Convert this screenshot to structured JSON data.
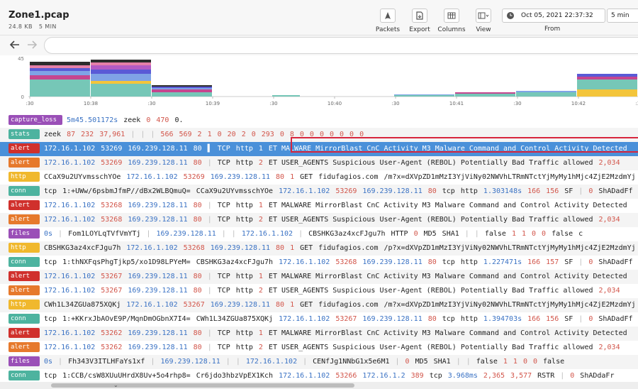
{
  "header": {
    "title": "Zone1.pcap",
    "size": "24.8 KB",
    "duration": "5 MIN",
    "tools": [
      {
        "label": "Packets",
        "icon": "shark-fin-icon"
      },
      {
        "label": "Export",
        "icon": "export-file-icon"
      },
      {
        "label": "Columns",
        "icon": "columns-icon"
      },
      {
        "label": "View",
        "icon": "view-layout-icon"
      }
    ],
    "date": "Oct 05, 2021 22:37:32",
    "span": "5 min",
    "from_label": "From"
  },
  "search": {
    "placeholder": ""
  },
  "histogram": {
    "y_ticks": [
      "45",
      "0"
    ],
    "x_ticks": [
      ":30",
      "10:38",
      ":30",
      "10:39",
      ":30",
      "10:40",
      ":30",
      "10:41",
      ":30",
      "10:42",
      ":30"
    ],
    "colors": [
      "#76c7b7",
      "#f3c53b",
      "#c5468f",
      "#7fa3e6",
      "#5a5ad6",
      "#b45bc4",
      "#e57fa8",
      "#2c2c2c"
    ],
    "bars": [
      {
        "x": 42,
        "w": 86,
        "stack": [
          [
            0,
            24
          ],
          [
            2,
            6
          ],
          [
            3,
            6
          ],
          [
            4,
            4
          ],
          [
            6,
            4
          ],
          [
            7,
            5
          ]
        ]
      },
      {
        "x": 128,
        "w": 86,
        "stack": [
          [
            0,
            18
          ],
          [
            1,
            4
          ],
          [
            3,
            10
          ],
          [
            4,
            6
          ],
          [
            5,
            6
          ],
          [
            6,
            4
          ],
          [
            7,
            4
          ]
        ]
      },
      {
        "x": 214,
        "w": 86,
        "stack": [
          [
            0,
            6
          ],
          [
            2,
            4
          ],
          [
            3,
            2
          ],
          [
            4,
            2
          ],
          [
            7,
            2
          ]
        ]
      },
      {
        "x": 384,
        "w": 40,
        "stack": [
          [
            0,
            2
          ]
        ]
      },
      {
        "x": 556,
        "w": 86,
        "stack": [
          [
            0,
            2
          ],
          [
            3,
            1
          ]
        ]
      },
      {
        "x": 642,
        "w": 86,
        "stack": [
          [
            0,
            4
          ],
          [
            2,
            2
          ]
        ]
      },
      {
        "x": 728,
        "w": 86,
        "stack": [
          [
            0,
            6
          ],
          [
            3,
            2
          ]
        ]
      },
      {
        "x": 814,
        "w": 86,
        "stack": [
          [
            1,
            10
          ],
          [
            0,
            14
          ],
          [
            2,
            4
          ],
          [
            4,
            4
          ]
        ]
      }
    ]
  },
  "rows": [
    {
      "type": "capture_loss",
      "color": "#9a4fb7",
      "wide": true,
      "fields": [
        {
          "t": "5m45.501172s",
          "c": "dur"
        },
        {
          "t": "zeek"
        },
        {
          "t": "0",
          "c": "num"
        },
        {
          "t": "470",
          "c": "num"
        },
        {
          "t": "0."
        }
      ]
    },
    {
      "type": "stats",
      "color": "#4db39f",
      "fields": [
        {
          "t": "zeek"
        },
        {
          "t": "87",
          "c": "num"
        },
        {
          "t": "232",
          "c": "num"
        },
        {
          "t": "37,961",
          "c": "num"
        },
        {
          "t": "|",
          "c": "sep"
        },
        {
          "t": "|",
          "c": "sep"
        },
        {
          "t": "|",
          "c": "sep"
        },
        {
          "t": "566",
          "c": "num"
        },
        {
          "t": "569",
          "c": "num"
        },
        {
          "t": "2",
          "c": "num"
        },
        {
          "t": "1",
          "c": "num"
        },
        {
          "t": "0",
          "c": "num"
        },
        {
          "t": "20",
          "c": "num"
        },
        {
          "t": "2",
          "c": "num"
        },
        {
          "t": "0",
          "c": "num"
        },
        {
          "t": "293",
          "c": "num"
        },
        {
          "t": "0",
          "c": "num"
        },
        {
          "t": "8",
          "c": "num"
        },
        {
          "t": "0",
          "c": "num"
        },
        {
          "t": "0",
          "c": "num"
        },
        {
          "t": "0",
          "c": "num"
        },
        {
          "t": "0",
          "c": "num"
        },
        {
          "t": "0",
          "c": "num"
        },
        {
          "t": "0",
          "c": "num"
        },
        {
          "t": "0",
          "c": "num"
        }
      ]
    },
    {
      "type": "alert",
      "color": "#d0302c",
      "selected": true,
      "fields": [
        {
          "t": "172.16.1.102",
          "c": "ip"
        },
        {
          "t": "53269",
          "c": "num"
        },
        {
          "t": "169.239.128.11",
          "c": "ip"
        },
        {
          "t": "80",
          "c": "num"
        },
        {
          "t": "▌",
          "c": "sep"
        },
        {
          "t": "TCP"
        },
        {
          "t": "http"
        },
        {
          "t": "1",
          "c": "num"
        },
        {
          "t": "ET MALWARE MirrorBlast CnC Activity M3  Malware Command and Control Activity Detected"
        }
      ]
    },
    {
      "type": "alert",
      "color": "#e6792c",
      "fields": [
        {
          "t": "172.16.1.102",
          "c": "ip"
        },
        {
          "t": "53269",
          "c": "num"
        },
        {
          "t": "169.239.128.11",
          "c": "ip"
        },
        {
          "t": "80",
          "c": "num"
        },
        {
          "t": "|",
          "c": "sep"
        },
        {
          "t": "TCP"
        },
        {
          "t": "http"
        },
        {
          "t": "2",
          "c": "num"
        },
        {
          "t": "ET USER_AGENTS Suspicious User-Agent (REBOL)  Potentially Bad Traffic  allowed"
        },
        {
          "t": "2,034",
          "c": "num"
        }
      ]
    },
    {
      "type": "http",
      "color": "#f0b82d",
      "fields": [
        {
          "t": "CCaX9u2UYvmsschYOe"
        },
        {
          "t": "172.16.1.102",
          "c": "ip"
        },
        {
          "t": "53269",
          "c": "num"
        },
        {
          "t": "169.239.128.11",
          "c": "ip"
        },
        {
          "t": "80",
          "c": "num"
        },
        {
          "t": "1",
          "c": "num"
        },
        {
          "t": "GET"
        },
        {
          "t": "fidufagios.com"
        },
        {
          "t": "/m?x=dXVpZD1mMzI3YjViNy02NWVhLTRmNTctYjMyMy1hMjc4ZjE2MzdmYj"
        }
      ]
    },
    {
      "type": "conn",
      "color": "#4db39f",
      "fields": [
        {
          "t": "tcp"
        },
        {
          "t": "1:+UWw/6psbmJfmP//dBx2WLBQmuQ="
        },
        {
          "t": "CCaX9u2UYvmsschYOe"
        },
        {
          "t": "172.16.1.102",
          "c": "ip"
        },
        {
          "t": "53269",
          "c": "num"
        },
        {
          "t": "169.239.128.11",
          "c": "ip"
        },
        {
          "t": "80",
          "c": "num"
        },
        {
          "t": "tcp"
        },
        {
          "t": "http"
        },
        {
          "t": "1.303148s",
          "c": "dur"
        },
        {
          "t": "166",
          "c": "num"
        },
        {
          "t": "156",
          "c": "num"
        },
        {
          "t": "SF"
        },
        {
          "t": "|",
          "c": "sep"
        },
        {
          "t": "0",
          "c": "num"
        },
        {
          "t": "ShADadFf"
        }
      ]
    },
    {
      "type": "alert",
      "color": "#d0302c",
      "fields": [
        {
          "t": "172.16.1.102",
          "c": "ip"
        },
        {
          "t": "53268",
          "c": "num"
        },
        {
          "t": "169.239.128.11",
          "c": "ip"
        },
        {
          "t": "80",
          "c": "num"
        },
        {
          "t": "|",
          "c": "sep"
        },
        {
          "t": "TCP"
        },
        {
          "t": "http"
        },
        {
          "t": "1",
          "c": "num"
        },
        {
          "t": "ET MALWARE MirrorBlast CnC Activity M3  Malware Command and Control Activity Detected"
        }
      ]
    },
    {
      "type": "alert",
      "color": "#e6792c",
      "fields": [
        {
          "t": "172.16.1.102",
          "c": "ip"
        },
        {
          "t": "53268",
          "c": "num"
        },
        {
          "t": "169.239.128.11",
          "c": "ip"
        },
        {
          "t": "80",
          "c": "num"
        },
        {
          "t": "|",
          "c": "sep"
        },
        {
          "t": "TCP"
        },
        {
          "t": "http"
        },
        {
          "t": "2",
          "c": "num"
        },
        {
          "t": "ET USER_AGENTS Suspicious User-Agent (REBOL)  Potentially Bad Traffic  allowed"
        },
        {
          "t": "2,034",
          "c": "num"
        }
      ]
    },
    {
      "type": "files",
      "color": "#9a4fb7",
      "fields": [
        {
          "t": "0s",
          "c": "dur"
        },
        {
          "t": "|",
          "c": "sep"
        },
        {
          "t": "Fom1LOYLqTVfVmYTj"
        },
        {
          "t": "|",
          "c": "sep"
        },
        {
          "t": "169.239.128.11",
          "c": "ip"
        },
        {
          "t": "|",
          "c": "sep"
        },
        {
          "t": "|",
          "c": "sep"
        },
        {
          "t": "172.16.1.102",
          "c": "ip"
        },
        {
          "t": "|",
          "c": "sep"
        },
        {
          "t": "CBSHKG3az4xcFJgu7h"
        },
        {
          "t": "HTTP"
        },
        {
          "t": "0",
          "c": "num"
        },
        {
          "t": "MD5"
        },
        {
          "t": "SHA1"
        },
        {
          "t": "|",
          "c": "sep"
        },
        {
          "t": "|",
          "c": "sep"
        },
        {
          "t": "false"
        },
        {
          "t": "1",
          "c": "num"
        },
        {
          "t": "1",
          "c": "num"
        },
        {
          "t": "0",
          "c": "num"
        },
        {
          "t": "0",
          "c": "num"
        },
        {
          "t": "false"
        },
        {
          "t": "c"
        }
      ]
    },
    {
      "type": "http",
      "color": "#f0b82d",
      "fields": [
        {
          "t": "CBSHKG3az4xcFJgu7h"
        },
        {
          "t": "172.16.1.102",
          "c": "ip"
        },
        {
          "t": "53268",
          "c": "num"
        },
        {
          "t": "169.239.128.11",
          "c": "ip"
        },
        {
          "t": "80",
          "c": "num"
        },
        {
          "t": "1",
          "c": "num"
        },
        {
          "t": "GET"
        },
        {
          "t": "fidufagios.com"
        },
        {
          "t": "/p?x=dXVpZD1mMzI3YjViNy02NWVhLTRmNTctYjMyMy1hMjc4ZjE2MzdmYj"
        }
      ]
    },
    {
      "type": "conn",
      "color": "#4db39f",
      "fields": [
        {
          "t": "tcp"
        },
        {
          "t": "1:thNXFqsPhgTjkp5/xo1D98LPYeM="
        },
        {
          "t": "CBSHKG3az4xcFJgu7h"
        },
        {
          "t": "172.16.1.102",
          "c": "ip"
        },
        {
          "t": "53268",
          "c": "num"
        },
        {
          "t": "169.239.128.11",
          "c": "ip"
        },
        {
          "t": "80",
          "c": "num"
        },
        {
          "t": "tcp"
        },
        {
          "t": "http"
        },
        {
          "t": "1.227471s",
          "c": "dur"
        },
        {
          "t": "166",
          "c": "num"
        },
        {
          "t": "157",
          "c": "num"
        },
        {
          "t": "SF"
        },
        {
          "t": "|",
          "c": "sep"
        },
        {
          "t": "0",
          "c": "num"
        },
        {
          "t": "ShADadFf"
        }
      ]
    },
    {
      "type": "alert",
      "color": "#d0302c",
      "fields": [
        {
          "t": "172.16.1.102",
          "c": "ip"
        },
        {
          "t": "53267",
          "c": "num"
        },
        {
          "t": "169.239.128.11",
          "c": "ip"
        },
        {
          "t": "80",
          "c": "num"
        },
        {
          "t": "|",
          "c": "sep"
        },
        {
          "t": "TCP"
        },
        {
          "t": "http"
        },
        {
          "t": "1",
          "c": "num"
        },
        {
          "t": "ET MALWARE MirrorBlast CnC Activity M3  Malware Command and Control Activity Detected"
        }
      ]
    },
    {
      "type": "alert",
      "color": "#e6792c",
      "fields": [
        {
          "t": "172.16.1.102",
          "c": "ip"
        },
        {
          "t": "53267",
          "c": "num"
        },
        {
          "t": "169.239.128.11",
          "c": "ip"
        },
        {
          "t": "80",
          "c": "num"
        },
        {
          "t": "|",
          "c": "sep"
        },
        {
          "t": "TCP"
        },
        {
          "t": "http"
        },
        {
          "t": "2",
          "c": "num"
        },
        {
          "t": "ET USER_AGENTS Suspicious User-Agent (REBOL)  Potentially Bad Traffic  allowed"
        },
        {
          "t": "2,034",
          "c": "num"
        }
      ]
    },
    {
      "type": "http",
      "color": "#f0b82d",
      "fields": [
        {
          "t": "CWh1L34ZGUa875XQKj"
        },
        {
          "t": "172.16.1.102",
          "c": "ip"
        },
        {
          "t": "53267",
          "c": "num"
        },
        {
          "t": "169.239.128.11",
          "c": "ip"
        },
        {
          "t": "80",
          "c": "num"
        },
        {
          "t": "1",
          "c": "num"
        },
        {
          "t": "GET"
        },
        {
          "t": "fidufagios.com"
        },
        {
          "t": "/m?x=dXVpZD1mMzI3YjViNy02NWVhLTRmNTctYjMyMy1hMjc4ZjE2MzdmYj"
        }
      ]
    },
    {
      "type": "conn",
      "color": "#4db39f",
      "fields": [
        {
          "t": "tcp"
        },
        {
          "t": "1:+KKrxJbAOvE9P/MqnDmOGbnX7I4="
        },
        {
          "t": "CWh1L34ZGUa875XQKj"
        },
        {
          "t": "172.16.1.102",
          "c": "ip"
        },
        {
          "t": "53267",
          "c": "num"
        },
        {
          "t": "169.239.128.11",
          "c": "ip"
        },
        {
          "t": "80",
          "c": "num"
        },
        {
          "t": "tcp"
        },
        {
          "t": "http"
        },
        {
          "t": "1.394703s",
          "c": "dur"
        },
        {
          "t": "166",
          "c": "num"
        },
        {
          "t": "156",
          "c": "num"
        },
        {
          "t": "SF"
        },
        {
          "t": "|",
          "c": "sep"
        },
        {
          "t": "0",
          "c": "num"
        },
        {
          "t": "ShADadFf"
        }
      ]
    },
    {
      "type": "alert",
      "color": "#d0302c",
      "fields": [
        {
          "t": "172.16.1.102",
          "c": "ip"
        },
        {
          "t": "53262",
          "c": "num"
        },
        {
          "t": "169.239.128.11",
          "c": "ip"
        },
        {
          "t": "80",
          "c": "num"
        },
        {
          "t": "|",
          "c": "sep"
        },
        {
          "t": "TCP"
        },
        {
          "t": "http"
        },
        {
          "t": "1",
          "c": "num"
        },
        {
          "t": "ET MALWARE MirrorBlast CnC Activity M3  Malware Command and Control Activity Detected"
        }
      ]
    },
    {
      "type": "alert",
      "color": "#e6792c",
      "fields": [
        {
          "t": "172.16.1.102",
          "c": "ip"
        },
        {
          "t": "53262",
          "c": "num"
        },
        {
          "t": "169.239.128.11",
          "c": "ip"
        },
        {
          "t": "80",
          "c": "num"
        },
        {
          "t": "|",
          "c": "sep"
        },
        {
          "t": "TCP"
        },
        {
          "t": "http"
        },
        {
          "t": "2",
          "c": "num"
        },
        {
          "t": "ET USER_AGENTS Suspicious User-Agent (REBOL)  Potentially Bad Traffic  allowed"
        },
        {
          "t": "2,034",
          "c": "num"
        }
      ]
    },
    {
      "type": "files",
      "color": "#9a4fb7",
      "fields": [
        {
          "t": "0s",
          "c": "dur"
        },
        {
          "t": "|",
          "c": "sep"
        },
        {
          "t": "Fh343V3ITLHFaYs1xf"
        },
        {
          "t": "|",
          "c": "sep"
        },
        {
          "t": "169.239.128.11",
          "c": "ip"
        },
        {
          "t": "|",
          "c": "sep"
        },
        {
          "t": "|",
          "c": "sep"
        },
        {
          "t": "172.16.1.102",
          "c": "ip"
        },
        {
          "t": "|",
          "c": "sep"
        },
        {
          "t": "CENfJg1NNbG1x5e6M1"
        },
        {
          "t": "|",
          "c": "sep"
        },
        {
          "t": "0",
          "c": "num"
        },
        {
          "t": "MD5"
        },
        {
          "t": "SHA1"
        },
        {
          "t": "|",
          "c": "sep"
        },
        {
          "t": "|",
          "c": "sep"
        },
        {
          "t": "false"
        },
        {
          "t": "1",
          "c": "num"
        },
        {
          "t": "1",
          "c": "num"
        },
        {
          "t": "0",
          "c": "num"
        },
        {
          "t": "0",
          "c": "num"
        },
        {
          "t": "false"
        }
      ]
    },
    {
      "type": "conn",
      "color": "#4db39f",
      "fields": [
        {
          "t": "tcp"
        },
        {
          "t": "1:CCB/csW8XUuUHrdX8Uv+5o4rhp8="
        },
        {
          "t": "Cr6jdo3hbzVpEX1Kch"
        },
        {
          "t": "172.16.1.102",
          "c": "ip"
        },
        {
          "t": "53266",
          "c": "num"
        },
        {
          "t": "172.16.1.2",
          "c": "ip"
        },
        {
          "t": "389",
          "c": "num"
        },
        {
          "t": "tcp"
        },
        {
          "t": "3.968ms",
          "c": "dur"
        },
        {
          "t": "2,365",
          "c": "num"
        },
        {
          "t": "3,577",
          "c": "num"
        },
        {
          "t": "RSTR"
        },
        {
          "t": "|",
          "c": "sep"
        },
        {
          "t": "0",
          "c": "num"
        },
        {
          "t": "ShADdaFr"
        }
      ]
    }
  ]
}
